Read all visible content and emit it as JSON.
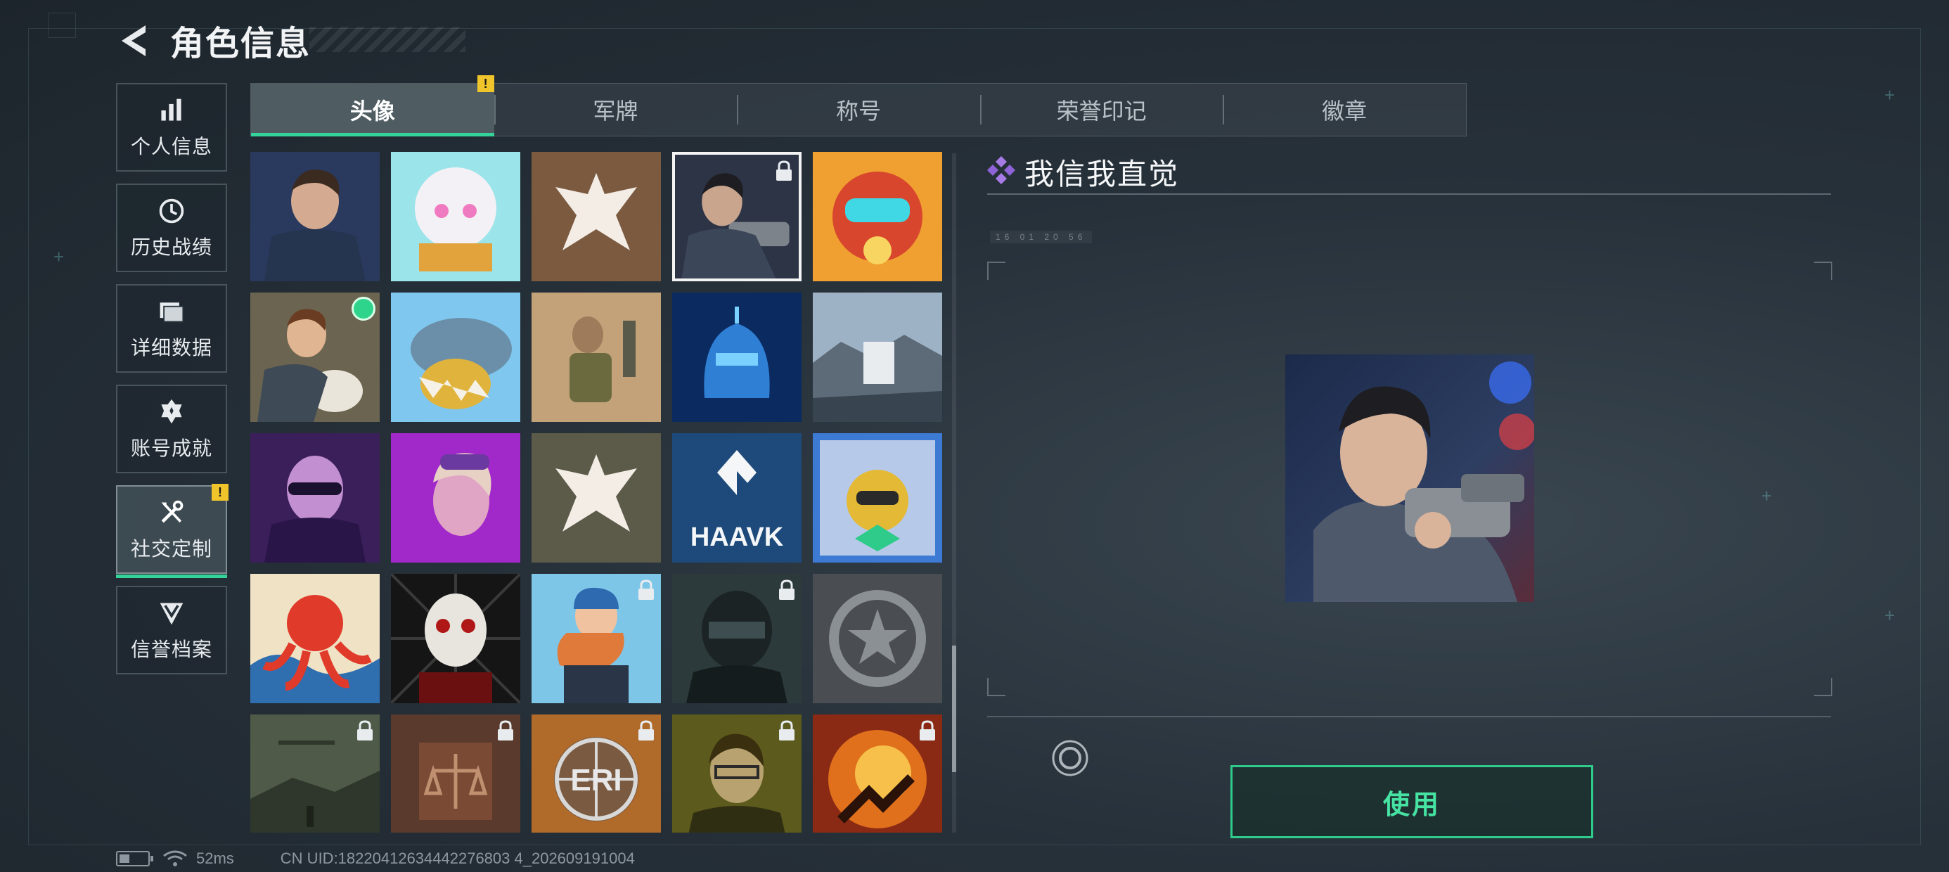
{
  "header": {
    "title": "角色信息"
  },
  "sidebar": {
    "items": [
      {
        "label": "个人信息",
        "icon": "bar-chart-icon",
        "active": false
      },
      {
        "label": "历史战绩",
        "icon": "history-clock-icon",
        "active": false
      },
      {
        "label": "详细数据",
        "icon": "folder-icon",
        "active": false
      },
      {
        "label": "账号成就",
        "icon": "medal-icon",
        "active": false
      },
      {
        "label": "社交定制",
        "icon": "tools-icon",
        "active": true,
        "badge": "!"
      },
      {
        "label": "信誉档案",
        "icon": "shield-chevron-icon",
        "active": false
      }
    ]
  },
  "tabs": [
    {
      "label": "头像",
      "active": true,
      "badge": "!"
    },
    {
      "label": "军牌",
      "active": false
    },
    {
      "label": "称号",
      "active": false
    },
    {
      "label": "荣誉印记",
      "active": false
    },
    {
      "label": "徽章",
      "active": false
    }
  ],
  "avatars": {
    "selected_index": 3,
    "locked": [
      3,
      17,
      18,
      20,
      21,
      22,
      23,
      24
    ],
    "new_dot": [
      5
    ],
    "hawk_logo_text": "HAAVK",
    "eri_logo_text": "ERI"
  },
  "detail": {
    "title": "我信我直觉",
    "meta": "16 01  20 56",
    "use_button": "使用"
  },
  "status_bar": {
    "ping": "52ms",
    "uid": "CN UID:18220412634442276803 4_202609191004"
  },
  "colors": {
    "accent": "#34d39a",
    "warning": "#f0c52b",
    "title_icon": "#9b6fe0"
  }
}
